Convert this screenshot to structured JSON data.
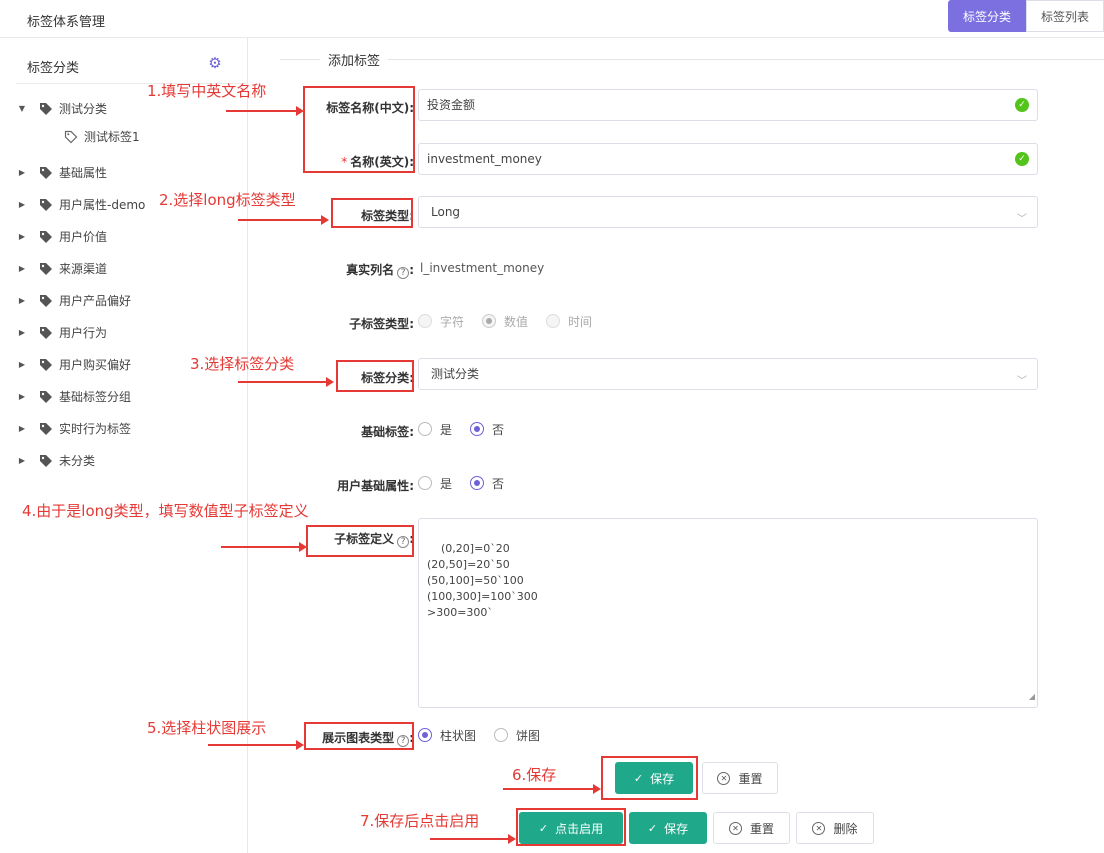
{
  "header": {
    "title": "标签体系管理",
    "tabs": [
      {
        "label": "标签分类",
        "active": true
      },
      {
        "label": "标签列表",
        "active": false
      }
    ]
  },
  "sidebar": {
    "title": "标签分类",
    "settings_icon": "gear-icon",
    "items": [
      {
        "label": "测试分类",
        "expanded": true
      },
      {
        "label": "测试标签1",
        "child": true
      },
      {
        "label": "基础属性"
      },
      {
        "label": "用户属性-demo"
      },
      {
        "label": "用户价值"
      },
      {
        "label": "来源渠道"
      },
      {
        "label": "用户产品偏好"
      },
      {
        "label": "用户行为"
      },
      {
        "label": "用户购买偏好"
      },
      {
        "label": "基础标签分组"
      },
      {
        "label": "实时行为标签"
      },
      {
        "label": "未分类"
      }
    ]
  },
  "form": {
    "section_title": "添加标签",
    "name_cn": {
      "label": "标签名称(中文)",
      "value": "投资金额"
    },
    "name_en": {
      "label": "名称(英文)",
      "required_mark": "*",
      "value": "investment_money"
    },
    "tag_type": {
      "label": "标签类型",
      "value": "Long"
    },
    "real_column": {
      "label": "真实列名",
      "value": "l_investment_money"
    },
    "sub_type": {
      "label": "子标签类型",
      "options": [
        {
          "label": "字符",
          "checked": false
        },
        {
          "label": "数值",
          "checked": true
        },
        {
          "label": "时间",
          "checked": false
        }
      ]
    },
    "category": {
      "label": "标签分类",
      "value": "测试分类"
    },
    "basic_tag": {
      "label": "基础标签",
      "options": [
        {
          "label": "是",
          "checked": false
        },
        {
          "label": "否",
          "checked": true
        }
      ]
    },
    "user_basic_attr": {
      "label": "用户基础属性",
      "options": [
        {
          "label": "是",
          "checked": false
        },
        {
          "label": "否",
          "checked": true
        }
      ]
    },
    "sub_def": {
      "label": "子标签定义",
      "value": "(0,20]=0`20\n(20,50]=20`50\n(50,100]=50`100\n(100,300]=100`300\n>300=300`"
    },
    "chart_type": {
      "label": "展示图表类型",
      "options": [
        {
          "label": "柱状图",
          "checked": true
        },
        {
          "label": "饼图",
          "checked": false
        }
      ]
    },
    "colon": ":"
  },
  "buttons": {
    "save": "保存",
    "reset": "重置",
    "enable": "点击启用",
    "save2": "保存",
    "reset2": "重置",
    "delete": "删除"
  },
  "annotations": {
    "a1": "1.填写中英文名称",
    "a2": "2.选择long标签类型",
    "a3": "3.选择标签分类",
    "a4": "4.由于是long类型，填写数值型子标签定义",
    "a5": "5.选择柱状图展示",
    "a6": "6.保存",
    "a7": "7.保存后点击启用"
  },
  "colors": {
    "accent": "#7c6fe0",
    "primary_button": "#1fa98a",
    "valid": "#52c41a",
    "annotation": "#e53935"
  }
}
